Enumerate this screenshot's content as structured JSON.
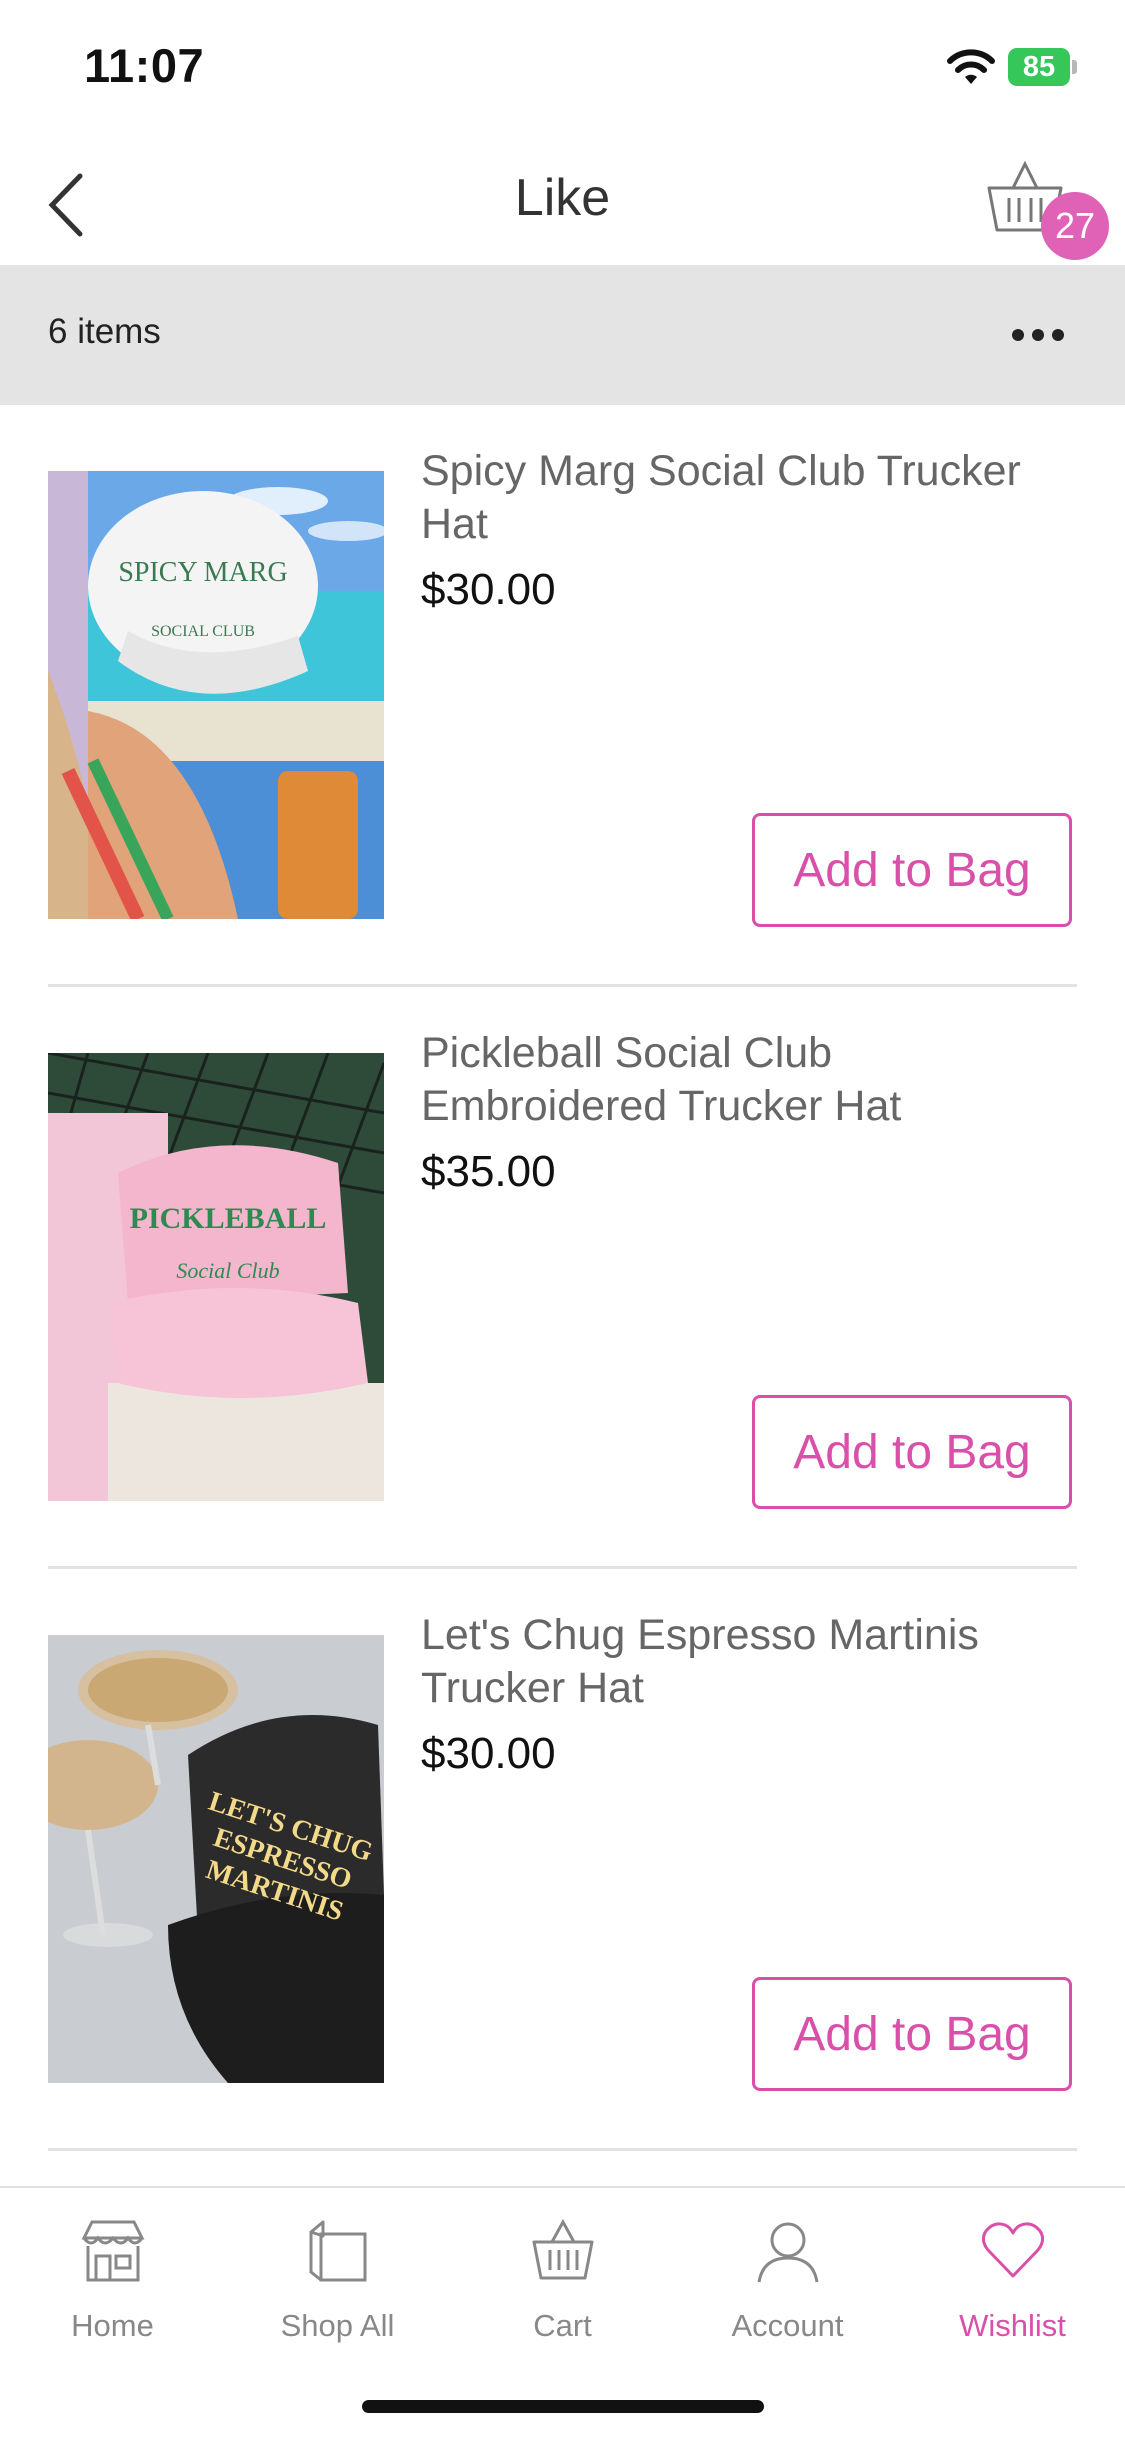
{
  "status_bar": {
    "time": "11:07",
    "battery": "85"
  },
  "header": {
    "title": "Like",
    "cart_count": "27"
  },
  "items_bar": {
    "count_label": "6 items"
  },
  "items": [
    {
      "name": "Spicy Marg Social Club Trucker Hat",
      "price": "$30.00",
      "button": "Add to Bag",
      "hat_text_1": "SPICY MARG",
      "hat_text_2": "SOCIAL CLUB"
    },
    {
      "name": "Pickleball Social Club Embroidered Trucker Hat",
      "price": "$35.00",
      "button": "Add to Bag",
      "hat_text_1": "PICKLEBALL",
      "hat_text_2": "Social Club"
    },
    {
      "name": "Let's Chug Espresso Martinis Trucker Hat",
      "price": "$30.00",
      "button": "Add to Bag",
      "hat_text_1": "LET'S CHUG",
      "hat_text_2": "ESPRESSO",
      "hat_text_3": "MARTINIS"
    }
  ],
  "tabs": [
    {
      "label": "Home",
      "icon": "store-icon"
    },
    {
      "label": "Shop All",
      "icon": "bag-icon"
    },
    {
      "label": "Cart",
      "icon": "basket-icon"
    },
    {
      "label": "Account",
      "icon": "person-icon"
    },
    {
      "label": "Wishlist",
      "icon": "heart-icon"
    }
  ],
  "colors": {
    "accent": "#d94fa9",
    "badge": "#e062b7",
    "bar": "#e4e4e4"
  }
}
